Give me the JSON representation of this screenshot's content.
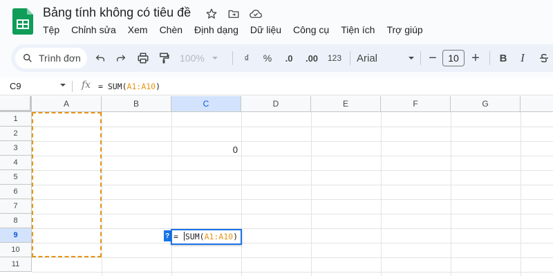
{
  "doc": {
    "title": "Bảng tính không có tiêu đề"
  },
  "title_icons": [
    "star-icon",
    "move-to-folder-icon",
    "cloud-saved-icon"
  ],
  "menu": [
    "Tệp",
    "Chỉnh sửa",
    "Xem",
    "Chèn",
    "Định dạng",
    "Dữ liệu",
    "Công cụ",
    "Tiện ích",
    "Trợ giúp"
  ],
  "toolbar": {
    "search_label": "Trình đơn",
    "zoom": "100%",
    "currency": "₫",
    "percent": "%",
    "decrease_decimal": ".0",
    "increase_decimal": ".00",
    "number_format": "123",
    "font": "Arial",
    "font_size": "10",
    "minus": "−",
    "plus": "+",
    "bold": "B",
    "italic": "I"
  },
  "formula_bar": {
    "cell_ref": "C9",
    "fx": "fx",
    "prefix": "= SUM(",
    "range": "A1:A10",
    "suffix": ")"
  },
  "columns": [
    "A",
    "B",
    "C",
    "D",
    "E",
    "F",
    "G"
  ],
  "rows": [
    "1",
    "2",
    "3",
    "4",
    "5",
    "6",
    "7",
    "8",
    "9",
    "10",
    "11"
  ],
  "active": {
    "column": "C",
    "row": "9"
  },
  "cells": {
    "C3": "0"
  },
  "editor": {
    "prefix": "= ",
    "func": "SUM(",
    "range": "A1:A10",
    "suffix": ")",
    "help_badge": "?"
  },
  "colors": {
    "accent": "#1a73e8",
    "range_highlight": "#e69518",
    "logo_green": "#0f9d58"
  }
}
